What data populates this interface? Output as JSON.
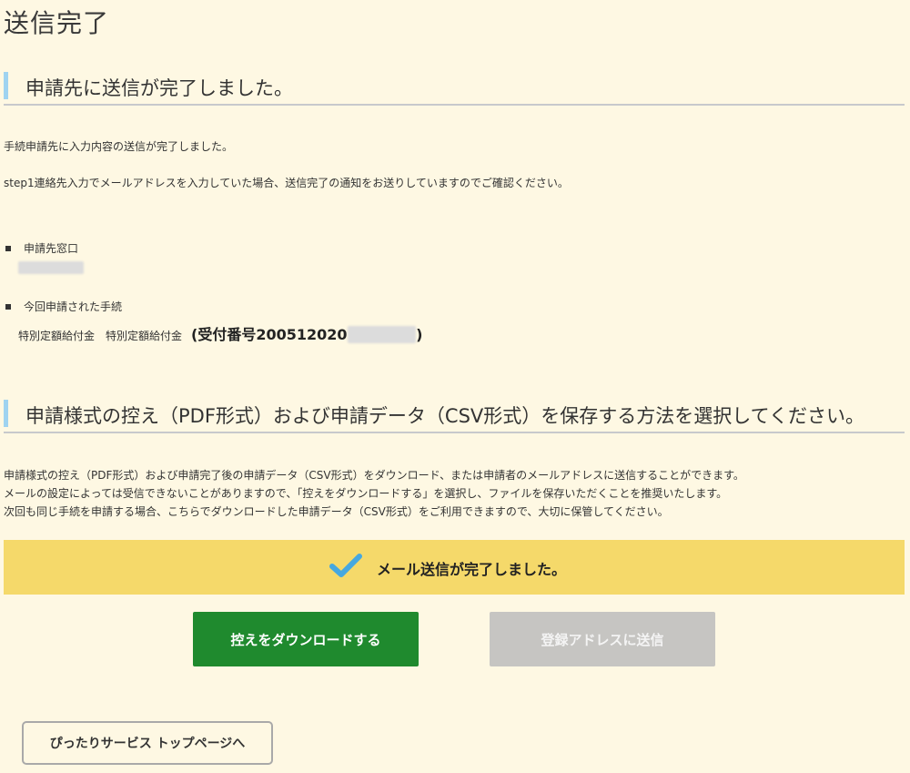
{
  "page": {
    "title": "送信完了"
  },
  "section1": {
    "heading": "申請先に送信が完了しました。",
    "para1": "手続申請先に入力内容の送信が完了しました。",
    "para2": "step1連絡先入力でメールアドレスを入力していた場合、送信完了の通知をお送りしていますのでご確認ください。",
    "office_label": "申請先窓口",
    "office_value": "■■■ ■■■",
    "procedure_label": "今回申請された手続",
    "procedure_value": "特別定額給付金　特別定額給付金",
    "receipt_prefix": "(受付番号200512020",
    "receipt_blurred": "■■■■■",
    "receipt_suffix": ")"
  },
  "section2": {
    "heading": "申請様式の控え（PDF形式）および申請データ（CSV形式）を保存する方法を選択してください。",
    "para1": "申請様式の控え（PDF形式）および申請完了後の申請データ（CSV形式）をダウンロード、または申請者のメールアドレスに送信することができます。",
    "para2": "メールの設定によっては受信できないことがありますので、「控えをダウンロードする」を選択し、ファイルを保存いただくことを推奨いたします。",
    "para3": "次回も同じ手続を申請する場合、こちらでダウンロードした申請データ（CSV形式）をご利用できますので、大切に保管してください。"
  },
  "banner": {
    "text": "メール送信が完了しました。",
    "icon": "check-icon",
    "color": "#f5d96a",
    "icon_color": "#46a8e0"
  },
  "buttons": {
    "download_label": "控えをダウンロードする",
    "send_label": "登録アドレスに送信",
    "top_label": "ぴったりサービス トップページへ"
  },
  "colors": {
    "background": "#fef8e3",
    "accent_bar": "#9fd3f0",
    "primary": "#1f8a2e",
    "disabled": "#c6c5c2"
  }
}
